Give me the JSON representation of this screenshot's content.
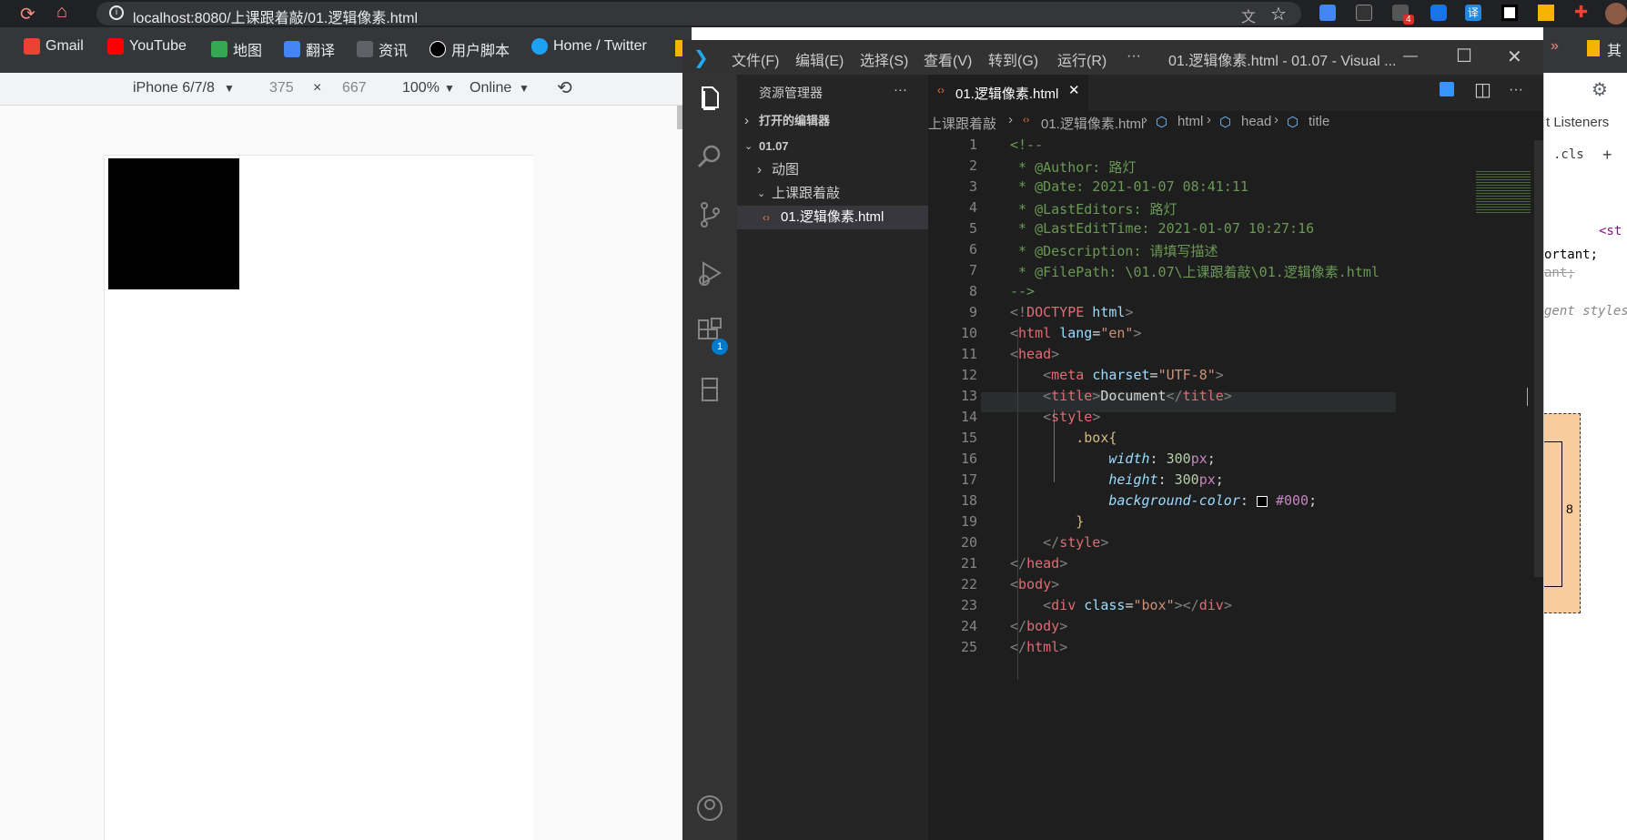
{
  "browser": {
    "url": "localhost:8080/上课跟着敲/01.逻辑像素.html",
    "bookmarks": [
      {
        "label": "Gmail",
        "icon": "gmail-icon",
        "color": "#ea4335"
      },
      {
        "label": "YouTube",
        "icon": "youtube-icon",
        "color": "#ff0000"
      },
      {
        "label": "地图",
        "icon": "maps-icon",
        "color": "#34a853"
      },
      {
        "label": "翻译",
        "icon": "translate-icon",
        "color": "#4285f4"
      },
      {
        "label": "资讯",
        "icon": "news-icon",
        "color": "#5f6368"
      },
      {
        "label": "用户脚本",
        "icon": "userscript-icon",
        "color": "#000000"
      },
      {
        "label": "Home / Twitter",
        "icon": "twitter-icon",
        "color": "#1da1f2"
      }
    ],
    "extension_badge": "4",
    "bookmark_more": "其"
  },
  "device_toolbar": {
    "device": "iPhone 6/7/8",
    "width": "375",
    "times": "×",
    "height": "667",
    "zoom": "100%",
    "network": "Online"
  },
  "vscode": {
    "menus": [
      "文件(F)",
      "编辑(E)",
      "选择(S)",
      "查看(V)",
      "转到(G)",
      "运行(R)",
      "···"
    ],
    "window_title": "01.逻辑像素.html - 01.07 - Visual ...",
    "explorer_title": "资源管理器",
    "explorer_more": "···",
    "open_editors": "打开的编辑器",
    "folder": "01.07",
    "tree": [
      "动图",
      "上课跟着敲",
      "01.逻辑像素.html"
    ],
    "extensions_badge": "1",
    "tab_label": "01.逻辑像素.html",
    "breadcrumb": [
      "上课跟着敲",
      "01.逻辑像素.html",
      "html",
      "head",
      "title"
    ],
    "line_numbers": [
      "1",
      "2",
      "3",
      "4",
      "5",
      "6",
      "7",
      "8",
      "9",
      "10",
      "11",
      "12",
      "13",
      "14",
      "15",
      "16",
      "17",
      "18",
      "19",
      "20",
      "21",
      "22",
      "23",
      "24",
      "25"
    ],
    "code": {
      "l1": "<!--",
      "l2": " * @Author: 路灯",
      "l3": " * @Date: 2021-01-07 08:41:11",
      "l4": " * @LastEditors: 路灯",
      "l5": " * @LastEditTime: 2021-01-07 10:27:16",
      "l6": " * @Description: 请填写描述",
      "l7": " * @FilePath: \\01.07\\上课跟着敲\\01.逻辑像素.html",
      "l8": "-->",
      "l9_a": "<!",
      "l9_b": "DOCTYPE",
      "l9_c": " html",
      "l9_d": ">",
      "l10_tag": "html",
      "l10_attr": "lang",
      "l10_val": "\"en\"",
      "l11_tag": "head",
      "l12_tag": "meta",
      "l12_attr": "charset",
      "l12_val": "\"UTF-8\"",
      "l13_tag": "title",
      "l13_text": "Document",
      "l14_tag": "style",
      "l15_sel": ".box{",
      "l16_prop": "width",
      "l16_num": "300",
      "l16_unit": "px",
      "l17_prop": "height",
      "l17_num": "300",
      "l17_unit": "px",
      "l18_prop": "background-color",
      "l18_val": "#000",
      "l19": "}",
      "l20_tag": "style",
      "l21_tag": "head",
      "l22_tag": "body",
      "l23_tag": "div",
      "l23_attr": "class",
      "l23_val": "\"box\"",
      "l24_tag": "body",
      "l25_tag": "html"
    }
  },
  "devtools_right": {
    "tab_partial": "t Listeners",
    "cls": ".cls",
    "plus": "+",
    "code1": "<st",
    "code2": "ortant;",
    "code3": "ant;",
    "code4": "gent styles",
    "box_number": "8"
  }
}
